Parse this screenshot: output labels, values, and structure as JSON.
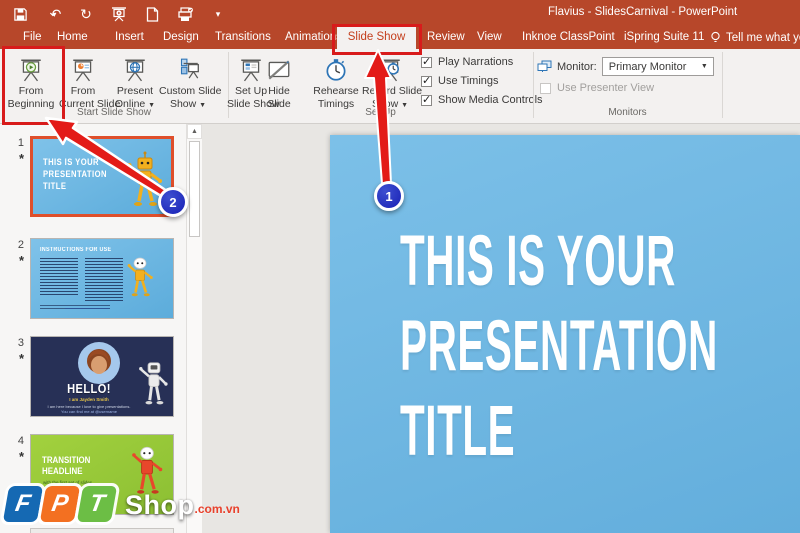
{
  "window": {
    "title": "Flavius - SlidesCarnival - PowerPoint"
  },
  "qat": {
    "icons": [
      "save",
      "undo",
      "redo",
      "start-from-beginning",
      "new-file",
      "print-preview",
      "customize-quick-access"
    ]
  },
  "tabs": [
    "File",
    "Home",
    "Insert",
    "Design",
    "Transitions",
    "Animations",
    "Slide Show",
    "Review",
    "View",
    "Inknoe ClassPoint",
    "iSpring Suite 11"
  ],
  "tellme": {
    "label": "Tell me what you",
    "icon": "lightbulb-icon"
  },
  "ribbon": {
    "group_labels": {
      "start": "Start Slide Show",
      "setup": "Set Up",
      "monitors": "Monitors"
    },
    "buttons": [
      {
        "label": "From Beginning",
        "lines": [
          "From",
          "Beginning"
        ],
        "dropdown": false,
        "icon": "screen-play-icon"
      },
      {
        "label": "From Current Slide",
        "lines": [
          "From",
          "Current Slide"
        ],
        "dropdown": false,
        "icon": "screen-chart-icon"
      },
      {
        "label": "Present Online",
        "lines": [
          "Present",
          "Online"
        ],
        "dropdown": true,
        "icon": "screen-globe-icon"
      },
      {
        "label": "Custom Slide Show",
        "lines": [
          "Custom Slide",
          "Show"
        ],
        "dropdown": true,
        "icon": "screen-list-icon"
      },
      {
        "label": "Set Up Slide Show",
        "lines": [
          "Set Up",
          "Slide Show"
        ],
        "dropdown": false,
        "icon": "screen-setup-icon"
      },
      {
        "label": "Hide Slide",
        "lines": [
          "Hide",
          "Slide"
        ],
        "dropdown": false,
        "icon": "hide-slide-icon"
      },
      {
        "label": "Rehearse Timings",
        "lines": [
          "Rehearse",
          "Timings"
        ],
        "dropdown": false,
        "icon": "stopwatch-icon"
      },
      {
        "label": "Record Slide Show",
        "lines": [
          "Record Slide",
          "Show"
        ],
        "dropdown": true,
        "icon": "screen-record-icon"
      }
    ],
    "checkboxes": [
      {
        "label": "Play Narrations",
        "checked": true
      },
      {
        "label": "Use Timings",
        "checked": true
      },
      {
        "label": "Show Media Controls",
        "checked": true
      }
    ],
    "monitor": {
      "label": "Monitor:",
      "value": "Primary Monitor",
      "icon": "monitor-icon"
    },
    "presenter": {
      "label": "Use Presenter View",
      "checked": false,
      "enabled": false
    }
  },
  "thumbnails": [
    {
      "number": "1",
      "star": "*",
      "selected": true,
      "lines": [
        "THIS IS YOUR",
        "PRESENTATION",
        "TITLE"
      ]
    },
    {
      "number": "2",
      "star": "*",
      "selected": false,
      "title": "INSTRUCTIONS FOR USE"
    },
    {
      "number": "3",
      "star": "*",
      "selected": false,
      "title": "HELLO!",
      "sub1": "I am Jayden Smith",
      "sub2": "I am here because I love to give presentations.",
      "sub3": "You can find me at @username"
    },
    {
      "number": "4",
      "star": "*",
      "selected": false,
      "lines": [
        "TRANSITION",
        "HEADLINE"
      ],
      "sub": "with the first set of slides"
    }
  ],
  "slide": {
    "lines": [
      "THIS IS YOUR",
      "PRESENTATION",
      "TITLE"
    ]
  },
  "badges": {
    "one": "1",
    "two": "2"
  },
  "watermark": {
    "f": "F",
    "p": "P",
    "t": "T",
    "shop": "Shop",
    "domain": ".com.vn"
  },
  "colors": {
    "titlebar": "#B7472A",
    "active_tab_text": "#C43E1C",
    "annotation_red": "#D81B1B",
    "badge_blue": "#1F2FC0",
    "selection_orange": "#DF4F2B",
    "slide_blue": "#6DB5E1",
    "slide_navy": "#273056",
    "slide_green": "#97CB3C"
  }
}
